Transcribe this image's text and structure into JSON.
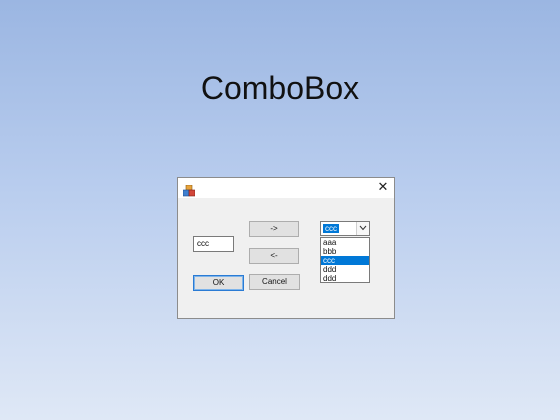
{
  "slide": {
    "title": "ComboBox"
  },
  "dialog": {
    "close_glyph": "✕",
    "app_icon": "app-icon",
    "move_right_label": "->",
    "move_left_label": "<-",
    "ok_label": "OK",
    "cancel_label": "Cancel",
    "textbox_value": "ccc",
    "combo": {
      "selected_value": "ccc",
      "items": [
        "aaa",
        "bbb",
        "ccc",
        "ddd",
        "ddd"
      ],
      "highlighted_index": 2
    }
  },
  "colors": {
    "selection": "#0078d7",
    "default_button_border": "#2a7bd4"
  }
}
